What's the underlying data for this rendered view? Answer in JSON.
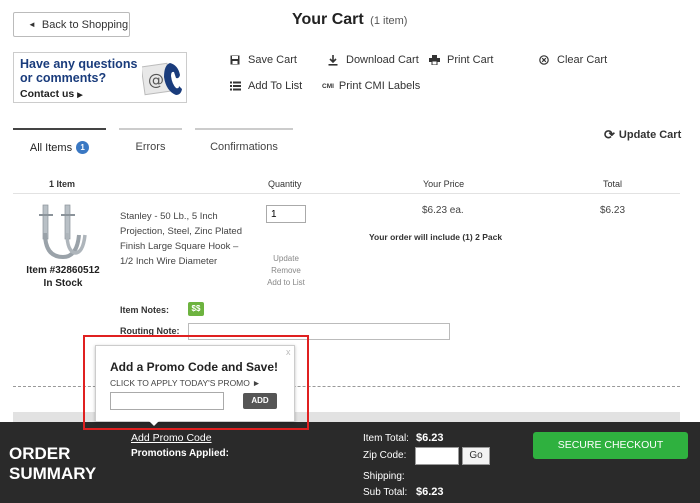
{
  "header": {
    "back_label": "Back to Shopping",
    "title": "Your Cart",
    "item_count": "(1 item)"
  },
  "contact": {
    "question": "Have any questions or comments?",
    "link": "Contact us"
  },
  "actions": {
    "save_cart": "Save Cart",
    "download_cart": "Download Cart",
    "print_cart": "Print Cart",
    "clear_cart": "Clear Cart",
    "add_to_list": "Add To List",
    "print_cmi": "Print CMI Labels",
    "cmi_icon_text": "CMI",
    "update_cart": "Update Cart"
  },
  "tabs": [
    {
      "label": "All Items",
      "badge": "1"
    },
    {
      "label": "Errors"
    },
    {
      "label": "Confirmations"
    }
  ],
  "table": {
    "headers": [
      "1  Item",
      "Quantity",
      "Your Price",
      "Total"
    ]
  },
  "item": {
    "description": "Stanley - 50 Lb., 5 Inch Projection, Steel, Zinc Plated Finish Large Square Hook – 1/2 Inch Wire Diameter",
    "quantity": "1",
    "links": [
      "Update",
      "Remove",
      "Add to List"
    ],
    "price": "$6.23  ea.",
    "total": "$6.23",
    "pack_note": "Your order will include (1) 2 Pack",
    "item_number": "Item #32860512",
    "stock": "In Stock",
    "notes_label": "Item Notes:",
    "notes_icon_text": "$$",
    "routing_label": "Routing Note:"
  },
  "summary": {
    "title_line1": "ORDER",
    "title_line2": "SUMMARY",
    "promo_link": "Add Promo Code",
    "promotions_applied": "Promotions Applied:",
    "item_total_label": "Item Total:",
    "item_total_value": "$6.23",
    "zip_label": "Zip Code:",
    "go_label": "Go",
    "shipping_label": "Shipping:",
    "subtotal_label": "Sub Total:",
    "subtotal_value": "$6.23",
    "checkout_label": "SECURE CHECKOUT"
  },
  "promo_popup": {
    "close": "x",
    "title": "Add a Promo Code and Save!",
    "subtitle": "CLICK TO APPLY TODAY'S PROMO ►",
    "add_label": "ADD"
  },
  "colors": {
    "accent_blue": "#3a78c3",
    "checkout_green": "#2fb13f",
    "highlight_red": "#e02020",
    "summary_bg": "#2a2a2a"
  }
}
